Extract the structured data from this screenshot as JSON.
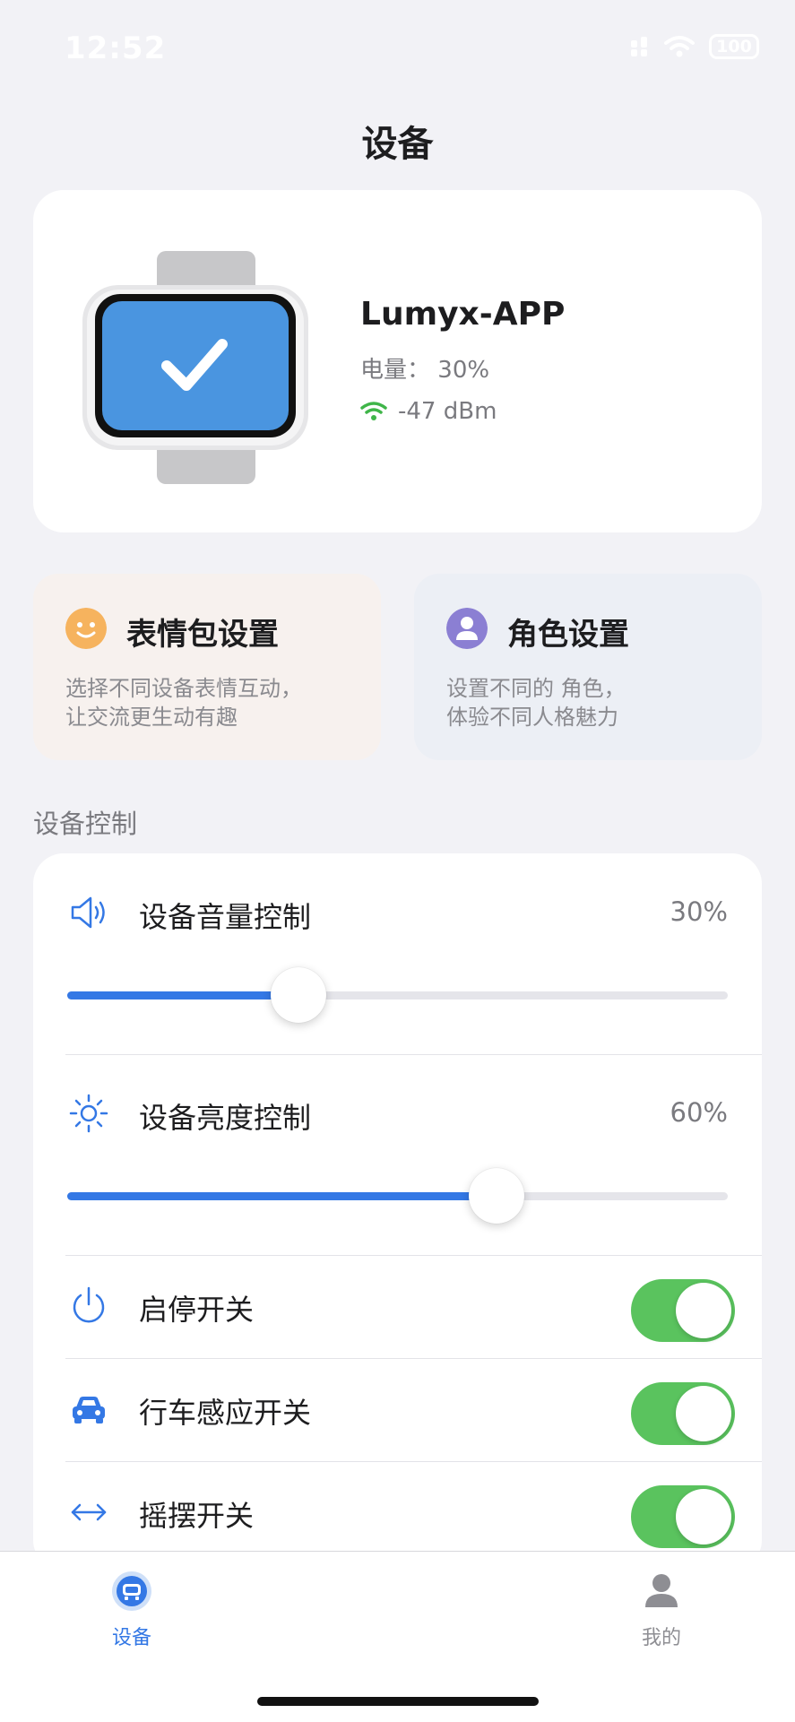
{
  "status_bar": {
    "time": "12:52",
    "battery": "100"
  },
  "header": {
    "title": "设备"
  },
  "device": {
    "name": "Lumyx-APP",
    "battery_label": "电量：",
    "battery_value": "30%",
    "signal": "-47 dBm"
  },
  "features": [
    {
      "title": "表情包设置",
      "desc_line1": "选择不同设备表情互动，",
      "desc_line2": "让交流更生动有趣",
      "icon": "smiley-icon",
      "icon_color": "#f6b35e"
    },
    {
      "title": "角色设置",
      "desc_line1": "设置不同的 角色，",
      "desc_line2": "体验不同人格魅力",
      "icon": "person-icon",
      "icon_color": "#8b7fd3"
    }
  ],
  "controls": {
    "section_title": "设备控制",
    "volume": {
      "label": "设备音量控制",
      "value": "30%",
      "level": 0.35
    },
    "brightness": {
      "label": "设备亮度控制",
      "value": "60%",
      "level": 0.65
    },
    "toggles": [
      {
        "label": "启停开关",
        "on": true,
        "icon": "power-icon"
      },
      {
        "label": "行车感应开关",
        "on": true,
        "icon": "car-icon"
      },
      {
        "label": "摇摆开关",
        "on": true,
        "icon": "swing-arrows-icon"
      }
    ]
  },
  "tab_bar": {
    "tabs": [
      {
        "label": "设备",
        "active": true,
        "icon": "device-tab-icon"
      },
      {
        "label": "我的",
        "active": false,
        "icon": "profile-tab-icon"
      }
    ]
  },
  "colors": {
    "accent": "#3478e5",
    "toggle_on": "#5ac35e",
    "signal": "#3fb549"
  }
}
